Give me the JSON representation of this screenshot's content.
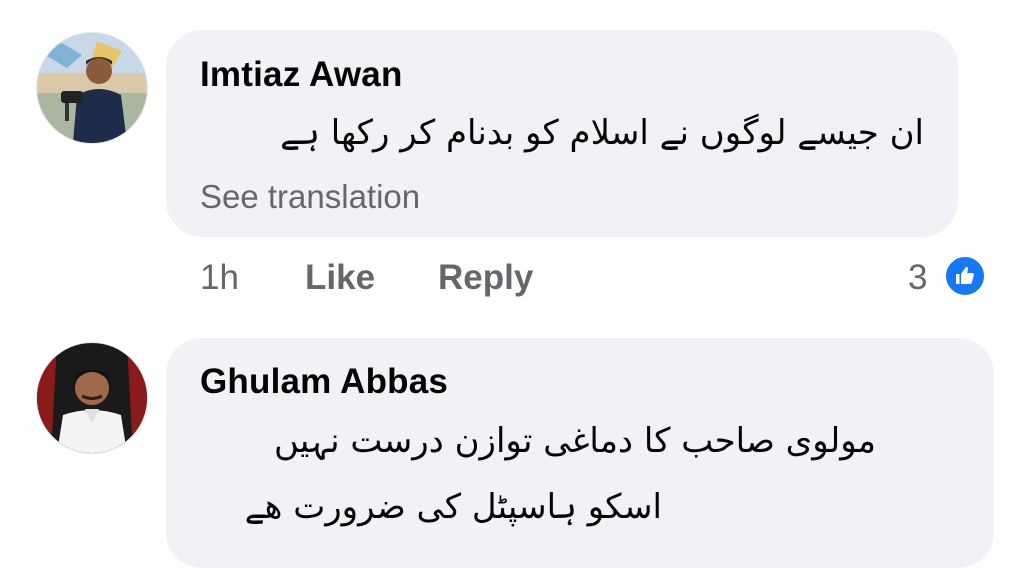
{
  "comments": [
    {
      "author": "Imtiaz Awan",
      "text_lines": [
        "ان جیسے لوگوں نے اسلام کو بدنام کر رکھا ہے"
      ],
      "see_translation": "See translation",
      "time": "1h",
      "like_label": "Like",
      "reply_label": "Reply",
      "reaction_count": "3",
      "reaction_icon": "like-icon"
    },
    {
      "author": "Ghulam Abbas",
      "text_lines": [
        "مولوی صاحب کا دماغی توازن درست نہیں",
        "اسکو ہاسپٹل کی ضرورت ھے"
      ]
    }
  ],
  "colors": {
    "bubble": "#f0f2f5",
    "secondary_text": "#65676b",
    "primary_text": "#050505",
    "like_blue": "#1877f2"
  }
}
